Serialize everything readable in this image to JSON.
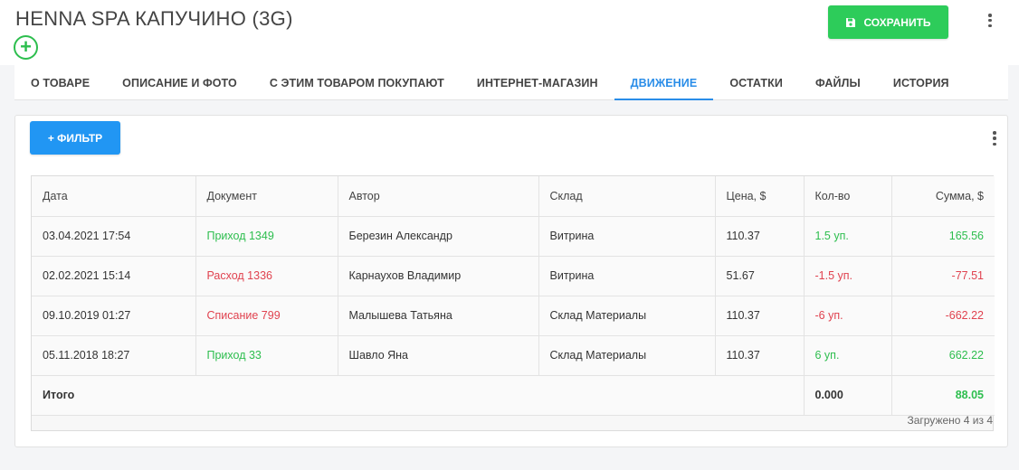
{
  "header": {
    "title": "HENNA SPA КАПУЧИНО (3G)",
    "save_label": "СОХРАНИТЬ",
    "add_symbol": "+"
  },
  "tabs": [
    {
      "label": "О ТОВАРЕ",
      "active": false
    },
    {
      "label": "ОПИСАНИЕ И ФОТО",
      "active": false
    },
    {
      "label": "С ЭТИМ ТОВАРОМ ПОКУПАЮТ",
      "active": false
    },
    {
      "label": "ИНТЕРНЕТ-МАГАЗИН",
      "active": false
    },
    {
      "label": "ДВИЖЕНИЕ",
      "active": true
    },
    {
      "label": "ОСТАТКИ",
      "active": false
    },
    {
      "label": "ФАЙЛЫ",
      "active": false
    },
    {
      "label": "ИСТОРИЯ",
      "active": false
    }
  ],
  "toolbar": {
    "filter_label": "+ ФИЛЬТР"
  },
  "table": {
    "columns": [
      "Дата",
      "Документ",
      "Автор",
      "Склад",
      "Цена, $",
      "Кол-во",
      "Сумма, $"
    ],
    "rows": [
      {
        "date": "03.04.2021 17:54",
        "doc": "Приход 1349",
        "author": "Березин Александр",
        "warehouse": "Витрина",
        "price": "110.37",
        "qty": "1.5 уп.",
        "sum": "165.56",
        "status": "income"
      },
      {
        "date": "02.02.2021 15:14",
        "doc": "Расход 1336",
        "author": "Карнаухов Владимир",
        "warehouse": "Витрина",
        "price": "51.67",
        "qty": "-1.5 уп.",
        "sum": "-77.51",
        "status": "expense"
      },
      {
        "date": "09.10.2019 01:27",
        "doc": "Списание 799",
        "author": "Малышева Татьяна",
        "warehouse": "Склад Материалы",
        "price": "110.37",
        "qty": "-6 уп.",
        "sum": "-662.22",
        "status": "expense"
      },
      {
        "date": "05.11.2018 18:27",
        "doc": "Приход 33",
        "author": "Шавло Яна",
        "warehouse": "Склад Материалы",
        "price": "110.37",
        "qty": "6 уп.",
        "sum": "662.22",
        "status": "income"
      }
    ],
    "total": {
      "label": "Итого",
      "qty": "0.000",
      "sum": "88.05"
    },
    "loaded_note": "Загружено 4 из 4"
  },
  "colors": {
    "accent": "#2a8de8",
    "save": "#2dcc5a",
    "filter": "#2196f3",
    "income": "#2dbe4e",
    "expense": "#e0424f"
  },
  "icons": {
    "save": "floppy-disk-icon",
    "menu": "kebab-menu-icon",
    "add": "plus-circle-icon"
  }
}
